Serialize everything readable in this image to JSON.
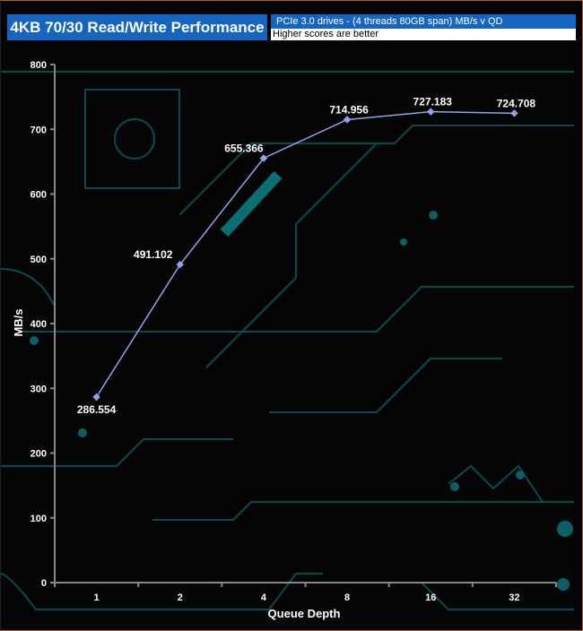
{
  "header": {
    "title": "4KB 70/30 Read/Write Performance",
    "subtitle": "PCIe 3.0 drives - (4 threads 80GB span) MB/s v QD",
    "note": "Higher scores are better"
  },
  "colors": {
    "title_bg": "#1565c0",
    "line": "#8fa3e8",
    "background": "#050505",
    "circuit": "#0b4f55"
  },
  "chart_data": {
    "type": "line",
    "title": "4KB 70/30 Read/Write Performance",
    "xlabel": "Queue Depth",
    "ylabel": "MB/s",
    "categories": [
      "1",
      "2",
      "4",
      "8",
      "16",
      "32"
    ],
    "series": [
      {
        "name": "MB/s",
        "values": [
          286.554,
          491.102,
          655.366,
          714.956,
          727.183,
          724.708
        ]
      }
    ],
    "value_labels": [
      "286.554",
      "491.102",
      "655.366",
      "714.956",
      "727.183",
      "724.708"
    ],
    "ylim": [
      0,
      800
    ],
    "yticks": [
      "0",
      "100",
      "200",
      "300",
      "400",
      "500",
      "600",
      "700",
      "800"
    ],
    "grid": false,
    "legend": "none"
  }
}
